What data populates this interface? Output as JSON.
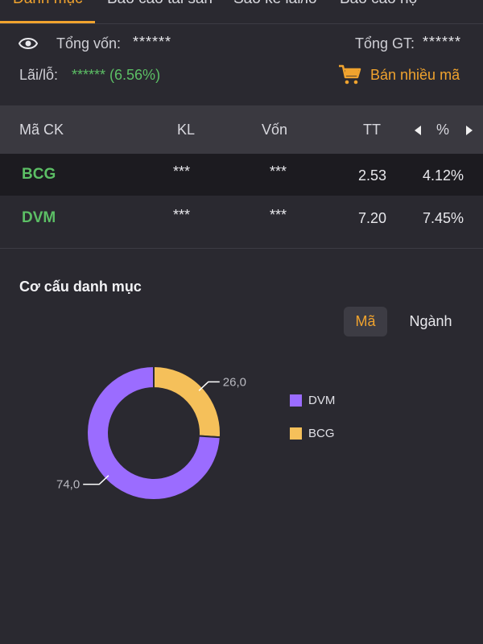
{
  "tabs": [
    {
      "label": "Danh mục",
      "active": true
    },
    {
      "label": "Báo cáo tài sản",
      "active": false
    },
    {
      "label": "Sao kê lãi/lỗ",
      "active": false
    },
    {
      "label": "Báo cáo hộ",
      "active": false
    }
  ],
  "summary": {
    "total_capital_label": "Tổng vốn:",
    "total_capital_value": "******",
    "total_value_label": "Tổng GT:",
    "total_value_value": "******",
    "pnl_label": "Lãi/lỗ:",
    "pnl_value": "****** (6.56%)",
    "sell_multi_label": "Bán nhiều mã"
  },
  "table": {
    "headers": {
      "symbol": "Mã CK",
      "qty": "KL",
      "capital": "Vốn",
      "tt": "TT",
      "pct": "%"
    },
    "rows": [
      {
        "symbol": "BCG",
        "qty": "***",
        "capital": "***",
        "tt": "2.53",
        "pct": "4.12%"
      },
      {
        "symbol": "DVM",
        "qty": "***",
        "capital": "***",
        "tt": "7.20",
        "pct": "7.45%"
      }
    ]
  },
  "allocation": {
    "title": "Cơ cấu danh mục",
    "toggle_code": "Mã",
    "toggle_sector": "Ngành"
  },
  "chart_data": {
    "type": "pie",
    "categories": [
      "DVM",
      "BCG"
    ],
    "values": [
      74.0,
      26.0
    ],
    "data_labels": [
      "74,0",
      "26,0"
    ],
    "colors": [
      "#9b6cff",
      "#f5c05a"
    ],
    "legend_position": "right"
  },
  "colors": {
    "accent": "#f0a32e",
    "positive": "#5cbf65",
    "background": "#2a2930"
  }
}
